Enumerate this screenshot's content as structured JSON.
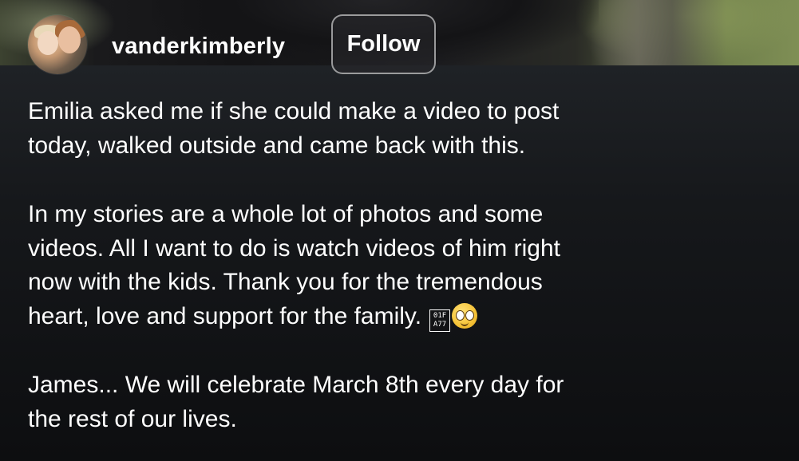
{
  "post": {
    "username": "vanderkimberly",
    "follow_label": "Follow",
    "caption": {
      "paragraphs": [
        "Emilia asked me if she could make a video to post\ntoday, walked outside and came back with this.",
        "In my stories are a whole lot of photos and some\nvideos. All I want to do is watch videos of him right\nnow with the kids. Thank you for the tremendous\nheart, love and support for the family.",
        "James... We will celebrate March 8th every day for\nthe rest of our lives."
      ],
      "emoji_missing_glyph": "01F\nA77",
      "emoji": "face-holding-back-tears"
    }
  },
  "colors": {
    "text": "#ffffff",
    "panel_bg": "#16181b",
    "follow_border": "#bfbfbf"
  }
}
